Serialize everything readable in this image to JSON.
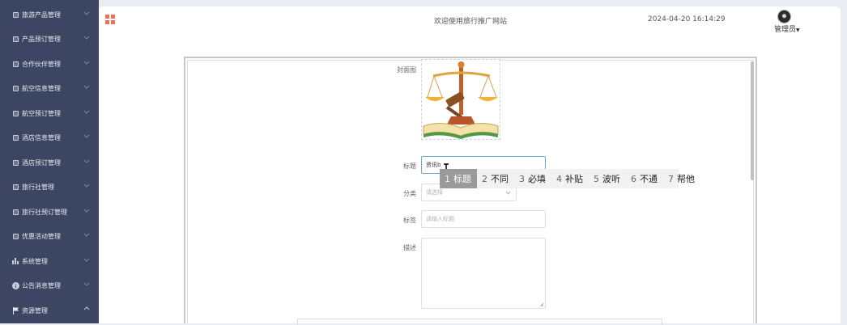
{
  "sidebar": {
    "items": [
      {
        "label": "旅游产品管理",
        "icon": "square-icon"
      },
      {
        "label": "产品预订管理",
        "icon": "square-icon"
      },
      {
        "label": "合作伙伴管理",
        "icon": "square-icon"
      },
      {
        "label": "航空信息管理",
        "icon": "square-icon"
      },
      {
        "label": "航空预订管理",
        "icon": "square-icon"
      },
      {
        "label": "酒店信息管理",
        "icon": "square-icon"
      },
      {
        "label": "酒店预订管理",
        "icon": "square-icon"
      },
      {
        "label": "旅行社管理",
        "icon": "square-icon"
      },
      {
        "label": "旅行社预订管理",
        "icon": "square-icon"
      },
      {
        "label": "优惠活动管理",
        "icon": "square-icon"
      },
      {
        "label": "系统管理",
        "icon": "bar-chart-icon"
      },
      {
        "label": "公告消息管理",
        "icon": "info-circle-icon"
      },
      {
        "label": "资源管理",
        "icon": "flag-icon"
      }
    ]
  },
  "header": {
    "welcome": "欢迎使用旅行推广网站",
    "datetime": "2024-04-20 16:14:29",
    "user": "管理员"
  },
  "form": {
    "cover_label": "封面图",
    "title_label": "标题",
    "title_value": "资讯b",
    "category_label": "分类",
    "category_placeholder": "请选择",
    "tag_label": "标签",
    "tag_placeholder": "请输入标题",
    "desc_label": "描述"
  },
  "ime": {
    "candidates": [
      {
        "num": "1",
        "text": "标题"
      },
      {
        "num": "2",
        "text": "不同"
      },
      {
        "num": "3",
        "text": "必填"
      },
      {
        "num": "4",
        "text": "补贴"
      },
      {
        "num": "5",
        "text": "波听"
      },
      {
        "num": "6",
        "text": "不通"
      },
      {
        "num": "7",
        "text": "帮他"
      }
    ]
  },
  "colors": {
    "sidebar_bg": "#3c4663",
    "accent": "#e8735a",
    "focus_border": "#6aa6d9"
  }
}
